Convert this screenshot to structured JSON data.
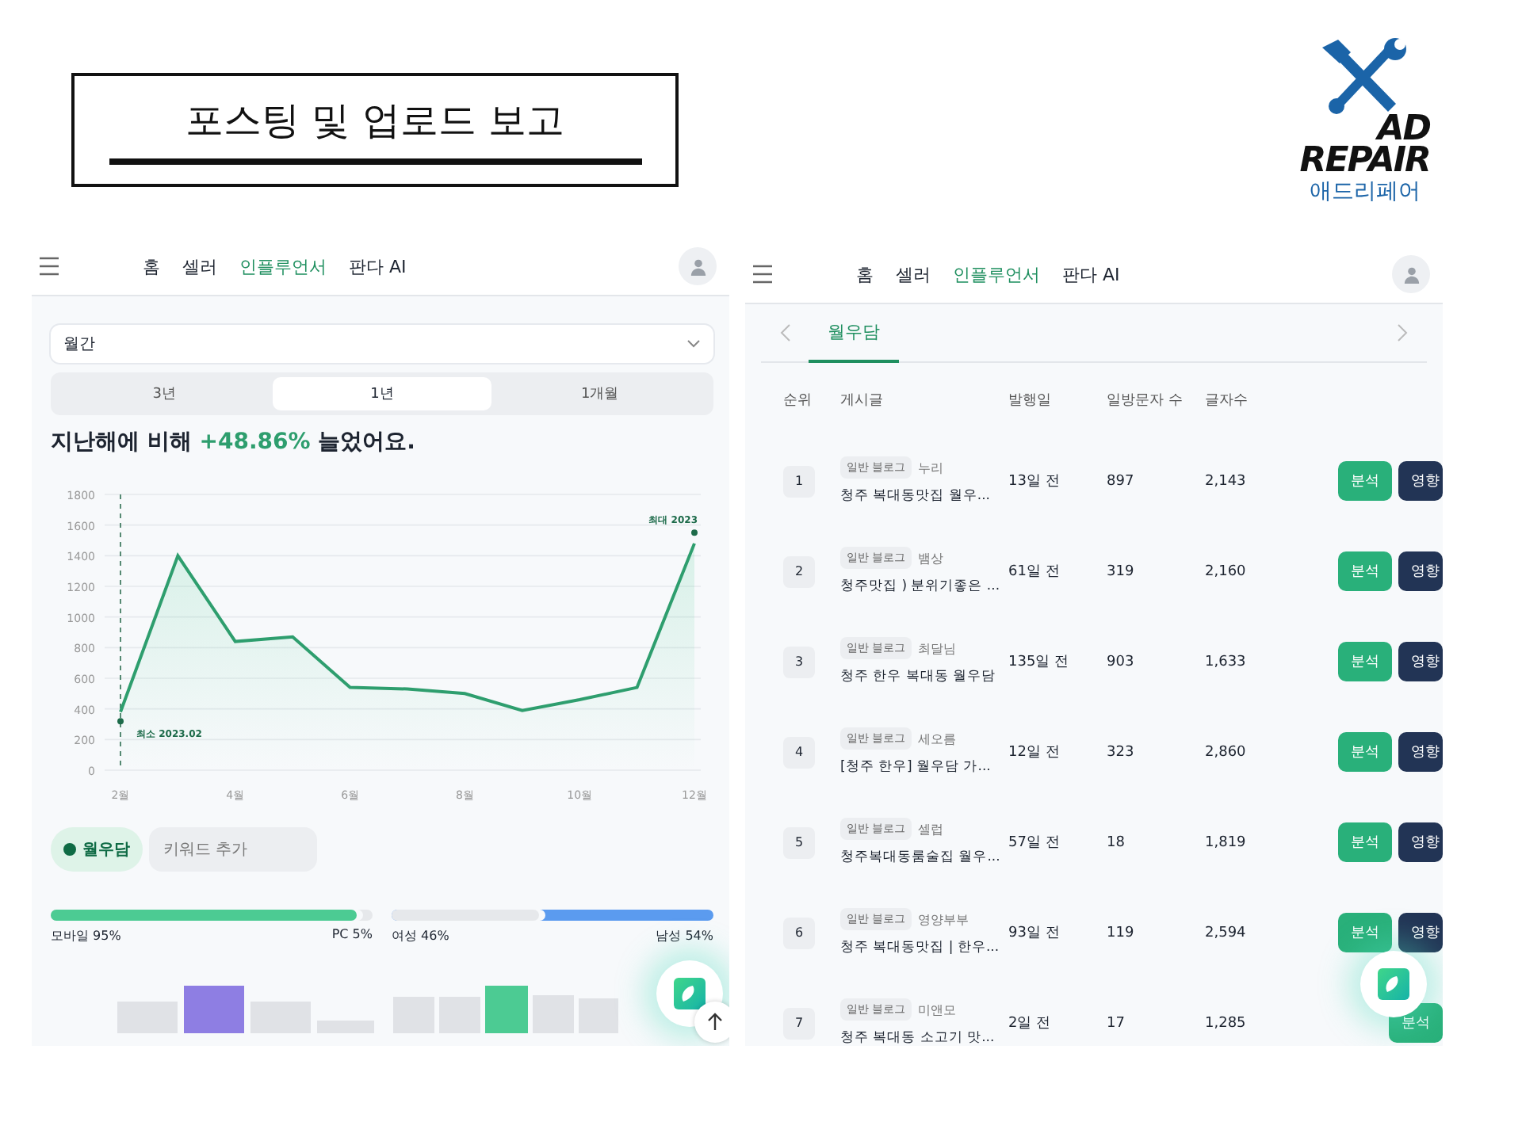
{
  "slide_title": "포스팅 및 업로드 보고",
  "logo": {
    "line1": "AD",
    "line2": "REPAIR",
    "korean": "애드리페어"
  },
  "left_panel": {
    "nav": [
      {
        "label": "홈",
        "selected": false
      },
      {
        "label": "셀러",
        "selected": false
      },
      {
        "label": "인플루언서",
        "selected": true
      },
      {
        "label": "판다 AI",
        "selected": false
      }
    ],
    "period_select": {
      "value": "월간"
    },
    "segments": [
      {
        "label": "3년",
        "selected": false
      },
      {
        "label": "1년",
        "selected": true
      },
      {
        "label": "1개월",
        "selected": false
      }
    ],
    "headline": {
      "before": "지난해에 비해",
      "change": "+48.86%",
      "after": "늘었어요."
    },
    "chart_data": {
      "type": "area",
      "x": [
        2,
        3,
        4,
        5,
        6,
        7,
        8,
        9,
        10,
        11,
        12
      ],
      "series": [
        {
          "color": "#2e9e6e",
          "values": [
            380,
            1400,
            840,
            870,
            540,
            530,
            500,
            390,
            460,
            540,
            1480
          ]
        }
      ],
      "xlim": [
        2,
        12
      ],
      "ylim": [
        0,
        1800
      ],
      "yticks": [
        0,
        200,
        400,
        600,
        800,
        1000,
        1200,
        1400,
        1600,
        1800
      ],
      "xticks": [
        {
          "value": 2,
          "label": "2월"
        },
        {
          "value": 4,
          "label": "4월"
        },
        {
          "value": 6,
          "label": "6월"
        },
        {
          "value": 8,
          "label": "8월"
        },
        {
          "value": 10,
          "label": "10월"
        },
        {
          "value": 12,
          "label": "12월"
        }
      ],
      "grid": true,
      "ref_lines": [
        {
          "axis": "x",
          "value": 2,
          "color": "#2e6e52"
        }
      ],
      "annotations": [
        {
          "text": "최소 2023.02",
          "x": 2,
          "y": 320
        },
        {
          "text": "최대 2023",
          "x": 12,
          "y": 1550
        }
      ]
    },
    "keyword_chip": {
      "label": "월우담"
    },
    "keyword_input": {
      "placeholder": "키워드 추가"
    },
    "ratios": [
      {
        "left": "모바일 95%",
        "right": "PC 5%",
        "level": 0.95,
        "kind": "left",
        "color": "#4ccb93"
      },
      {
        "left": "여성 46%",
        "right": "남성 54%",
        "level": 0.46,
        "kind": "right",
        "color": "#5b9bef"
      }
    ]
  },
  "right_panel": {
    "nav": [
      {
        "label": "홈",
        "selected": false
      },
      {
        "label": "셀러",
        "selected": false
      },
      {
        "label": "인플루언서",
        "selected": true
      },
      {
        "label": "판다 AI",
        "selected": false
      }
    ],
    "tabs": [
      {
        "label": "월우담",
        "selected": true
      }
    ],
    "columns": [
      "순위",
      "게시글",
      "발행일",
      "일방문자 수",
      "글자수"
    ],
    "rows": [
      {
        "rank": "1",
        "source": "일반 블로그",
        "author": "누리",
        "title": "청주 복대동맛집 월우...",
        "date": "13일 전",
        "visitors": "897",
        "chars": "2,143",
        "actions": [
          "분석",
          "영향"
        ]
      },
      {
        "rank": "2",
        "source": "일반 블로그",
        "author": "뱀상",
        "title": "청주맛집 ) 분위기좋은 ...",
        "date": "61일 전",
        "visitors": "319",
        "chars": "2,160",
        "actions": [
          "분석",
          "영향"
        ]
      },
      {
        "rank": "3",
        "source": "일반 블로그",
        "author": "최달님",
        "title": "청주 한우 복대동 월우담",
        "date": "135일 전",
        "visitors": "903",
        "chars": "1,633",
        "actions": [
          "분석",
          "영향"
        ]
      },
      {
        "rank": "4",
        "source": "일반 블로그",
        "author": "세오름",
        "title": "[청주 한우] 월우담 가...",
        "date": "12일 전",
        "visitors": "323",
        "chars": "2,860",
        "actions": [
          "분석",
          "영향"
        ]
      },
      {
        "rank": "5",
        "source": "일반 블로그",
        "author": "셀럽",
        "title": "청주복대동룸술집 월우...",
        "date": "57일 전",
        "visitors": "18",
        "chars": "1,819",
        "actions": [
          "분석",
          "영향"
        ]
      },
      {
        "rank": "6",
        "source": "일반 블로그",
        "author": "영양부부",
        "title": "청주 복대동맛집 | 한우...",
        "date": "93일 전",
        "visitors": "119",
        "chars": "2,594",
        "actions": [
          "분석",
          "영향"
        ]
      },
      {
        "rank": "7",
        "source": "일반 블로그",
        "author": "미앤모",
        "title": "청주 복대동 소고기 맛...",
        "date": "2일 전",
        "visitors": "17",
        "chars": "1,285",
        "actions": [
          "분석"
        ]
      }
    ]
  }
}
